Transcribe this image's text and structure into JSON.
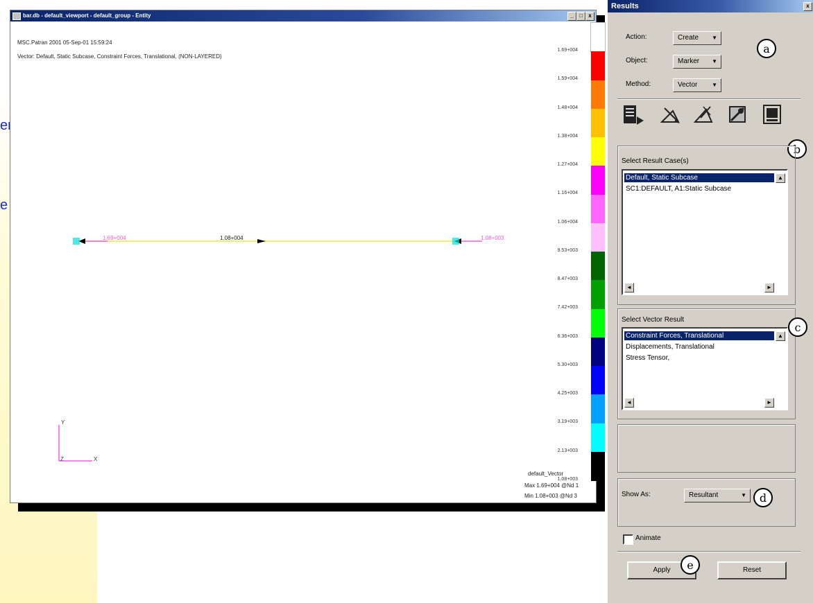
{
  "side_text": [
    "er",
    "e"
  ],
  "viewport": {
    "title": "bar.db - default_viewport - default_group - Entity",
    "window_buttons": [
      "_",
      "□",
      "x"
    ],
    "info_line1": "MSC.Patran 2001  05-Sep-01 15:59:24",
    "info_line2": "Vector: Default, Static Subcase, Constraint Forces, Translational, (NON-LAYERED)",
    "left_value": "1.69+004",
    "center_value": "1.08+004",
    "right_value": "1.08+003",
    "axis": {
      "y": "Y",
      "z": "Z",
      "x": "X"
    },
    "legend_name": "default_Vector",
    "legend_max": "Max 1.69+004 @Nd 1",
    "legend_min": "Min 1.08+003 @Nd 3"
  },
  "legend": {
    "ticks": [
      "1.69+004",
      "1.59+004",
      "1.48+004",
      "1.38+004",
      "1.27+004",
      "1.16+004",
      "1.06+004",
      "9.53+003",
      "8.47+003",
      "7.42+003",
      "6.36+003",
      "5.30+003",
      "4.25+003",
      "3.19+003",
      "2.13+003",
      "1.08+003"
    ],
    "colors": [
      "#ffffff",
      "#ff0000",
      "#ff7a00",
      "#ffc000",
      "#ffff00",
      "#ff00ff",
      "#ff66ff",
      "#ffc0ff",
      "#006400",
      "#00a000",
      "#00ff00",
      "#000080",
      "#0000ff",
      "#00a0ff",
      "#00ffff",
      "#000000"
    ]
  },
  "results": {
    "title": "Results",
    "close": "x",
    "action_label": "Action:",
    "action_value": "Create",
    "object_label": "Object:",
    "object_value": "Marker",
    "method_label": "Method:",
    "method_value": "Vector",
    "result_case_label": "Select Result Case(s)",
    "result_cases": [
      "Default, Static Subcase",
      "SC1:DEFAULT, A1:Static Subcase"
    ],
    "vector_label": "Select Vector Result",
    "vector_results": [
      "Constraint Forces, Translational",
      "Displacements, Translational",
      "Stress Tensor,"
    ],
    "show_as_label": "Show As:",
    "show_as_value": "Resultant",
    "animate_label": "Animate",
    "apply_label": "Apply",
    "reset_label": "Reset",
    "callouts": [
      "a",
      "b",
      "c",
      "d",
      "e"
    ],
    "scroll": {
      "up": "▲",
      "left": "◄",
      "right": "►"
    }
  },
  "arrow_glyph": "▼"
}
